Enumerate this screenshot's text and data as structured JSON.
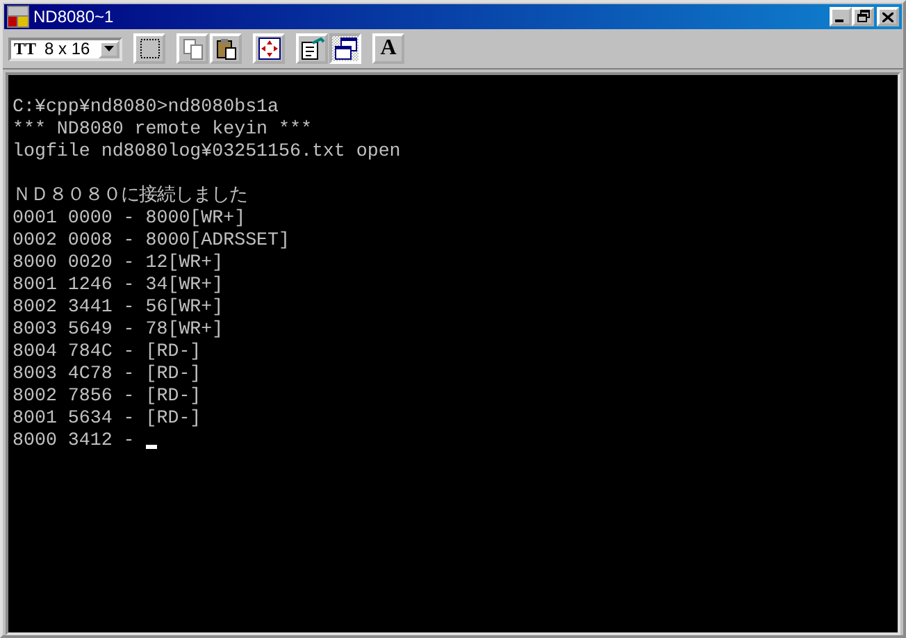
{
  "window": {
    "title": "ND8080~1"
  },
  "toolbar": {
    "font_size": {
      "icon_text": "TT",
      "value": "8 x 16"
    },
    "buttons": [
      {
        "kind": "mark",
        "pressed": false
      },
      {
        "kind": "copy",
        "pressed": false
      },
      {
        "kind": "paste",
        "pressed": false
      },
      {
        "kind": "fullscreen",
        "pressed": false
      },
      {
        "kind": "properties",
        "pressed": false
      },
      {
        "kind": "background",
        "pressed": true
      },
      {
        "kind": "font",
        "label": "A",
        "pressed": false
      }
    ]
  },
  "console": {
    "blocks": [
      {
        "lines": [
          {
            "text": "C:¥cpp¥nd8080>nd8080bs1a"
          },
          {
            "text": "*** ND8080 remote keyin ***"
          },
          {
            "text": "logfile nd8080log¥03251156.txt open"
          }
        ]
      },
      {
        "lines": [
          {
            "text": "ＮＤ８０８０に接続しました"
          },
          {
            "text": "0001 0000 - 8000[WR+]"
          },
          {
            "text": "0002 0008 - 8000[ADRSSET]"
          },
          {
            "text": "8000 0020 - 12[WR+]"
          },
          {
            "text": "8001 1246 - 34[WR+]"
          },
          {
            "text": "8002 3441 - 56[WR+]"
          },
          {
            "text": "8003 5649 - 78[WR+]"
          },
          {
            "text": "8004 784C - [RD-]"
          },
          {
            "text": "8003 4C78 - [RD-]"
          },
          {
            "text": "8002 7856 - [RD-]"
          },
          {
            "text": "8001 5634 - [RD-]"
          },
          {
            "text": "8000 3412 - ",
            "cursor": true
          }
        ]
      }
    ]
  }
}
